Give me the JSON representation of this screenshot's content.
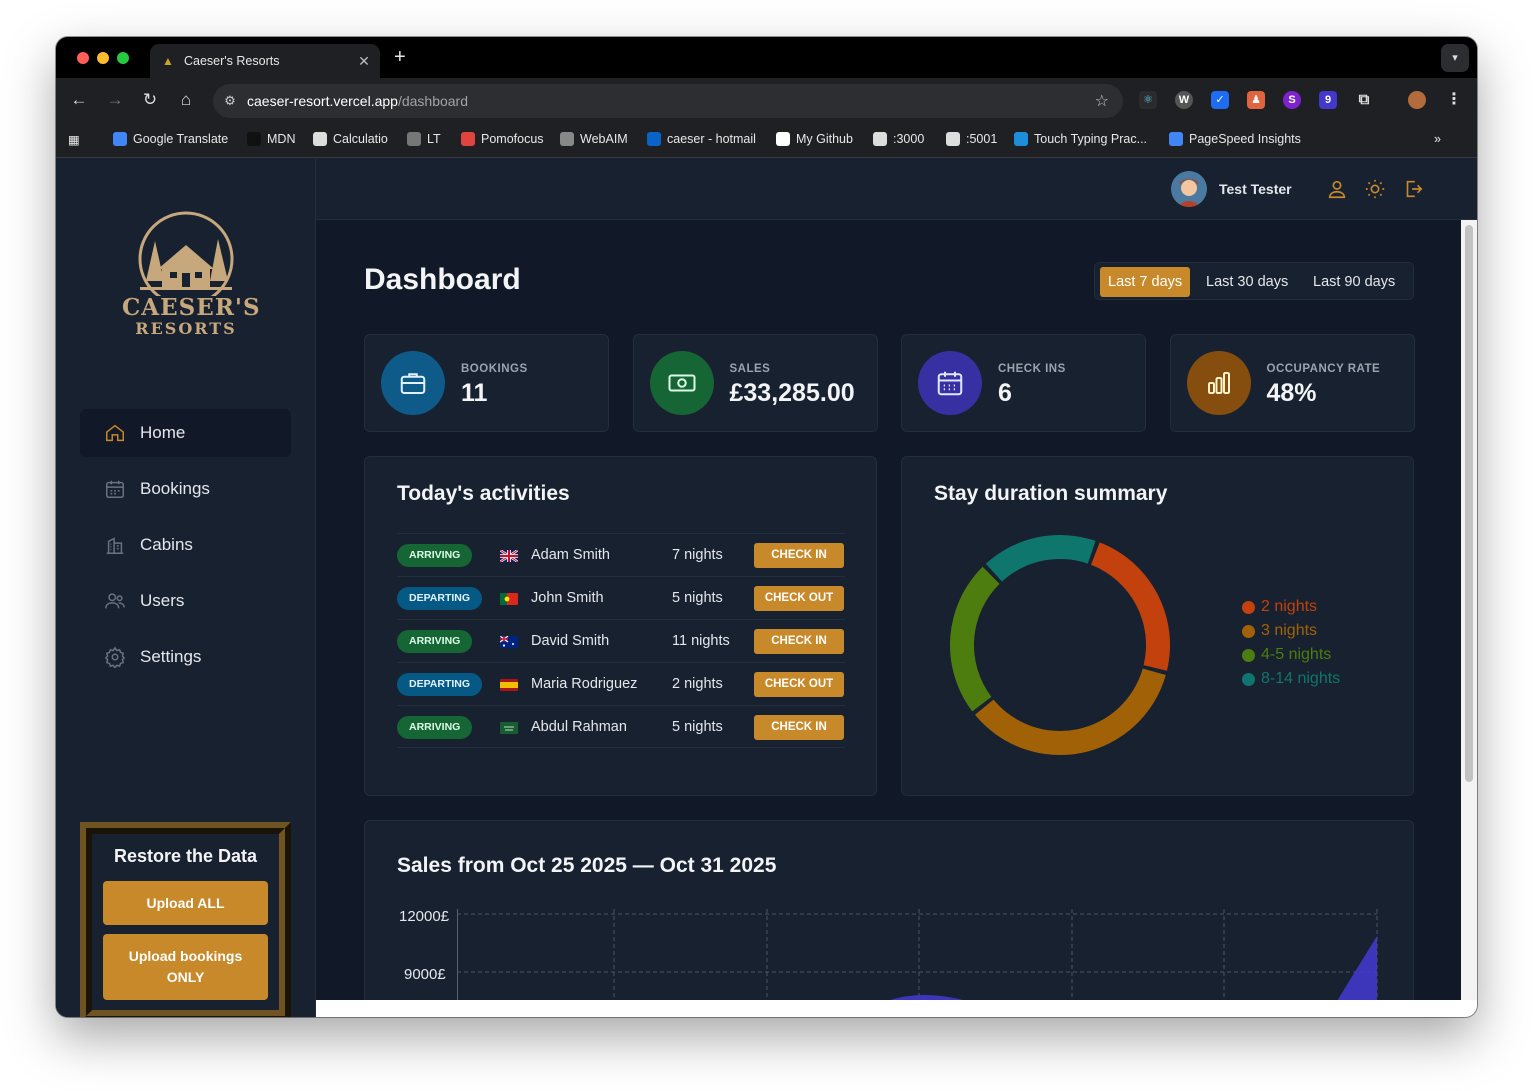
{
  "browser": {
    "tab_title": "Caeser's Resorts",
    "url_host": "caeser-resort.vercel.app",
    "url_path": "/dashboard",
    "bookmarks": [
      {
        "label": "Google Translate",
        "color": "#4285f4"
      },
      {
        "label": "MDN",
        "color": "#111111"
      },
      {
        "label": "Calculatio",
        "color": "#dddddd"
      },
      {
        "label": "LT",
        "color": "#777777"
      },
      {
        "label": "Pomofocus",
        "color": "#e0443e"
      },
      {
        "label": "WebAIM",
        "color": "#888888"
      },
      {
        "label": "caeser - hotmail",
        "color": "#0a64c8"
      },
      {
        "label": "My Github",
        "color": "#ffffff"
      },
      {
        "label": ":3000",
        "color": "#dddddd"
      },
      {
        "label": ":5001",
        "color": "#dddddd"
      },
      {
        "label": "Touch Typing Prac...",
        "color": "#1d8fd8"
      },
      {
        "label": "PageSpeed Insights",
        "color": "#4285f4"
      }
    ]
  },
  "brand": {
    "name_line1": "CAESER'S",
    "name_line2": "RESORTS",
    "accent": "#c8892a"
  },
  "sidebar": {
    "items": [
      {
        "label": "Home",
        "icon": "home-icon",
        "active": true
      },
      {
        "label": "Bookings",
        "icon": "calendar-icon"
      },
      {
        "label": "Cabins",
        "icon": "building-icon"
      },
      {
        "label": "Users",
        "icon": "users-icon"
      },
      {
        "label": "Settings",
        "icon": "gear-icon"
      }
    ],
    "restore": {
      "title": "Restore the Data",
      "upload_all": "Upload ALL",
      "upload_bookings": "Upload bookings ONLY"
    }
  },
  "header": {
    "user_name": "Test Tester"
  },
  "dashboard": {
    "title": "Dashboard",
    "ranges": [
      "Last 7 days",
      "Last 30 days",
      "Last 90 days"
    ],
    "selected_range": "Last 7 days",
    "stats": [
      {
        "label": "BOOKINGS",
        "value": "11",
        "color": "#0c4a6e",
        "icon": "briefcase-icon"
      },
      {
        "label": "SALES",
        "value": "£33,285.00",
        "color": "#14532d",
        "icon": "banknote-icon"
      },
      {
        "label": "CHECK INS",
        "value": "6",
        "color": "#312e81",
        "icon": "calendar-days-icon"
      },
      {
        "label": "OCCUPANCY RATE",
        "value": "48%",
        "color": "#713f12",
        "icon": "chart-bar-icon"
      }
    ],
    "activities": {
      "title": "Today's activities",
      "rows": [
        {
          "status": "ARRIVING",
          "flag": "gb",
          "guest": "Adam Smith",
          "nights": "7 nights",
          "action": "CHECK IN"
        },
        {
          "status": "DEPARTING",
          "flag": "pt",
          "guest": "John Smith",
          "nights": "5 nights",
          "action": "CHECK OUT"
        },
        {
          "status": "ARRIVING",
          "flag": "au",
          "guest": "David Smith",
          "nights": "11 nights",
          "action": "CHECK IN"
        },
        {
          "status": "DEPARTING",
          "flag": "es",
          "guest": "Maria Rodriguez",
          "nights": "2 nights",
          "action": "CHECK OUT"
        },
        {
          "status": "ARRIVING",
          "flag": "sa",
          "guest": "Abdul Rahman",
          "nights": "5 nights",
          "action": "CHECK IN"
        }
      ]
    },
    "stay_summary": {
      "title": "Stay duration summary",
      "chart_data": {
        "type": "pie",
        "categories": [
          "2 nights",
          "3 nights",
          "4-5 nights",
          "8-14 nights"
        ],
        "values": [
          2,
          3,
          2,
          1.5
        ],
        "colors": [
          "#c2410c",
          "#a16207",
          "#4d7c0f",
          "#0f766e"
        ],
        "legend": "right"
      }
    },
    "sales": {
      "title": "Sales from Oct 25 2025 — Oct 31 2025",
      "chart_data": {
        "type": "area",
        "ylabel_ticks": [
          "12000£",
          "9000£"
        ],
        "ylim_visible": [
          9000,
          12000
        ],
        "grid": true
      }
    }
  }
}
